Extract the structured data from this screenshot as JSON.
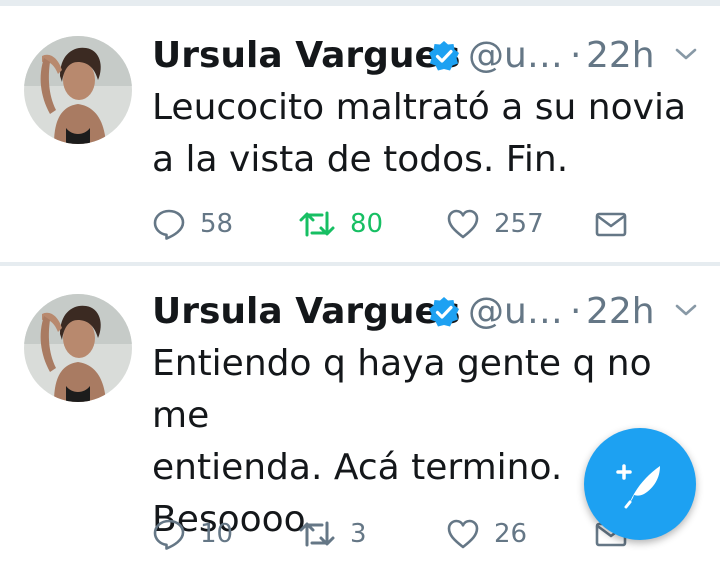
{
  "colors": {
    "accent": "#1da1f2",
    "retweet_active": "#17bf63",
    "muted": "#657786",
    "text": "#14171a"
  },
  "tweets": [
    {
      "author": "Ursula Vargues",
      "verified": true,
      "handle": "@u…",
      "separator": "·",
      "time": "22h",
      "text": "Leucocito maltrató a su novia\na la vista de todos. Fin.",
      "replies": "58",
      "retweets": "80",
      "retweeted": true,
      "likes": "257"
    },
    {
      "author": "Ursula Vargues",
      "verified": true,
      "handle": "@u…",
      "separator": "·",
      "time": "22h",
      "text": "Entiendo q haya gente q no me\nentienda. Acá termino.\nBesoooo",
      "replies": "10",
      "retweets": "3",
      "retweeted": false,
      "likes": "26"
    }
  ],
  "icons": {
    "reply": "reply-icon",
    "retweet": "retweet-icon",
    "like": "heart-icon",
    "dm": "mail-icon",
    "compose": "compose-tweet-icon",
    "verified": "verified-badge-icon",
    "caret": "chevron-down-icon"
  }
}
